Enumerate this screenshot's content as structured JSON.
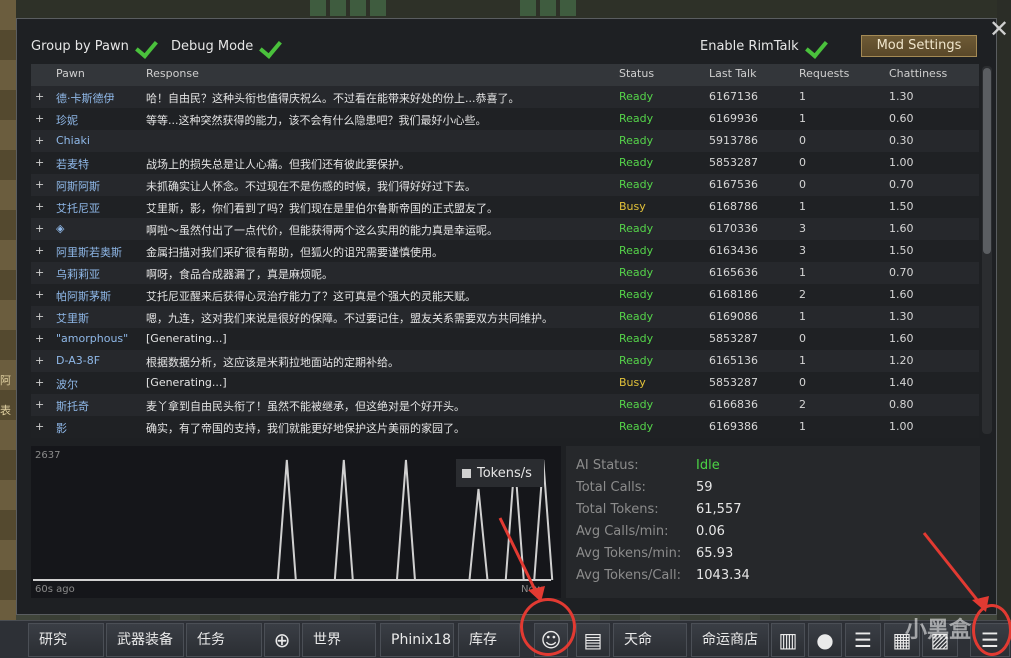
{
  "header": {
    "group_by_pawn": "Group by Pawn",
    "debug_mode": "Debug Mode",
    "enable_rimtalk": "Enable RimTalk",
    "mod_settings": "Mod Settings",
    "close": "✕"
  },
  "table": {
    "columns": [
      "Pawn",
      "Response",
      "Status",
      "Last Talk",
      "Requests",
      "Chattiness"
    ],
    "rows": [
      {
        "pawn": "德·卡斯德伊",
        "response": "哈！自由民？这种头衔也值得庆祝么。不过看在能带来好处的份上...恭喜了。",
        "status": "Ready",
        "last": "6167136",
        "req": "1",
        "chat": "1.30"
      },
      {
        "pawn": "珍妮",
        "response": "等等...这种突然获得的能力，该不会有什么隐患吧？我们最好小心些。",
        "status": "Ready",
        "last": "6169936",
        "req": "1",
        "chat": "0.60"
      },
      {
        "pawn": "Chiaki",
        "response": "",
        "status": "Ready",
        "last": "5913786",
        "req": "0",
        "chat": "0.30"
      },
      {
        "pawn": "若麦特",
        "response": "战场上的损失总是让人心痛。但我们还有彼此要保护。",
        "status": "Ready",
        "last": "5853287",
        "req": "0",
        "chat": "1.00"
      },
      {
        "pawn": "阿斯阿斯",
        "response": "未抓确实让人怀念。不过现在不是伤感的时候，我们得好好过下去。",
        "status": "Ready",
        "last": "6167536",
        "req": "0",
        "chat": "0.70"
      },
      {
        "pawn": "艾托尼亚",
        "response": "艾里斯，影，你们看到了吗？我们现在是里伯尔鲁斯帝国的正式盟友了。",
        "status": "Busy",
        "last": "6168786",
        "req": "1",
        "chat": "1.50"
      },
      {
        "pawn": "◈",
        "response": "啊啦～虽然付出了一点代价，但能获得两个这么实用的能力真是幸运呢。",
        "status": "Ready",
        "last": "6170336",
        "req": "3",
        "chat": "1.60"
      },
      {
        "pawn": "阿里斯若奥斯",
        "response": "金属扫描对我们采矿很有帮助，但狐火的诅咒需要谨慎使用。",
        "status": "Ready",
        "last": "6163436",
        "req": "3",
        "chat": "1.50"
      },
      {
        "pawn": "乌莉莉亚",
        "response": "啊呀，食品合成器漏了，真是麻烦呢。",
        "status": "Ready",
        "last": "6165636",
        "req": "1",
        "chat": "0.70"
      },
      {
        "pawn": "帕阿斯茅斯",
        "response": "艾托尼亚醒来后获得心灵治疗能力了？这可真是个强大的灵能天赋。",
        "status": "Ready",
        "last": "6168186",
        "req": "2",
        "chat": "1.60"
      },
      {
        "pawn": "艾里斯",
        "response": "嗯，九连，这对我们来说是很好的保障。不过要记住，盟友关系需要双方共同维护。",
        "status": "Ready",
        "last": "6169086",
        "req": "1",
        "chat": "1.30"
      },
      {
        "pawn": "\"amorphous\"",
        "response": "[Generating...]",
        "status": "Ready",
        "last": "5853287",
        "req": "0",
        "chat": "1.60"
      },
      {
        "pawn": "D-A3-8F",
        "response": "根据数据分析，这应该是米莉拉地面站的定期补给。",
        "status": "Ready",
        "last": "6165136",
        "req": "1",
        "chat": "1.20"
      },
      {
        "pawn": "波尔",
        "response": "[Generating...]",
        "status": "Busy",
        "last": "5853287",
        "req": "0",
        "chat": "1.40"
      },
      {
        "pawn": "斯托奇",
        "response": "麦丫拿到自由民头衔了！虽然不能被继承，但这绝对是个好开头。",
        "status": "Ready",
        "last": "6166836",
        "req": "2",
        "chat": "0.80"
      },
      {
        "pawn": "影",
        "response": "确实，有了帝国的支持，我们就能更好地保护这片美丽的家园了。",
        "status": "Ready",
        "last": "6169386",
        "req": "1",
        "chat": "1.00"
      }
    ]
  },
  "chart_data": {
    "type": "line",
    "series": [
      {
        "name": "Tokens/s",
        "x": [
          0,
          0.02,
          0.04,
          0.06,
          0.08,
          0.1,
          0.12,
          0.14,
          0.16,
          0.18,
          0.2,
          0.22,
          0.24,
          0.26,
          0.28,
          0.3,
          0.32,
          0.34,
          0.36,
          0.38,
          0.4,
          0.42,
          0.44,
          0.46,
          0.48,
          0.5,
          0.52,
          0.54,
          0.56,
          0.58,
          0.6,
          0.62,
          0.64,
          0.66,
          0.68,
          0.7,
          0.72,
          0.74,
          0.76,
          0.78,
          0.8,
          0.82,
          0.84,
          0.86,
          0.88,
          0.9,
          0.92,
          0.94,
          0.96,
          0.98,
          1.0
        ],
        "values": [
          0,
          0,
          0,
          0,
          0,
          0,
          0,
          0,
          0,
          0,
          0,
          0,
          0,
          0,
          0,
          0,
          0,
          0,
          0,
          0,
          0,
          0,
          0,
          0,
          0,
          0,
          0,
          0,
          0,
          0,
          0,
          0,
          0,
          0,
          0,
          0,
          0,
          0,
          0,
          0,
          0,
          0,
          0,
          0,
          0,
          0,
          0,
          0,
          0,
          0,
          0
        ]
      }
    ],
    "peaks": [
      {
        "x": 0.49,
        "value": 2637
      },
      {
        "x": 0.6,
        "value": 2637
      },
      {
        "x": 0.72,
        "value": 2637
      },
      {
        "x": 0.86,
        "value": 2000
      },
      {
        "x": 0.93,
        "value": 2637
      },
      {
        "x": 0.985,
        "value": 2637
      }
    ],
    "ylim": [
      0,
      2637
    ],
    "ymax_label": "2637",
    "x_left_label": "60s ago",
    "x_right_label": "Now",
    "legend": "Tokens/s",
    "line_color": "#d0d0d0"
  },
  "stats": [
    {
      "k": "AI Status:",
      "v": "Idle"
    },
    {
      "k": "Total Calls:",
      "v": "59"
    },
    {
      "k": "Total Tokens:",
      "v": "61,557"
    },
    {
      "k": "Avg Calls/min:",
      "v": "0.06"
    },
    {
      "k": "Avg Tokens/min:",
      "v": "65.93"
    },
    {
      "k": "Avg Tokens/Call:",
      "v": "1043.34"
    }
  ],
  "bottombar": {
    "tabs": [
      "研究",
      "武器装备",
      "任务",
      "世界",
      "Phinix18",
      "库存",
      "天命",
      "命运商店"
    ],
    "watermark": "小黑盒"
  },
  "map_left_labels": [
    "阿",
    "表"
  ]
}
